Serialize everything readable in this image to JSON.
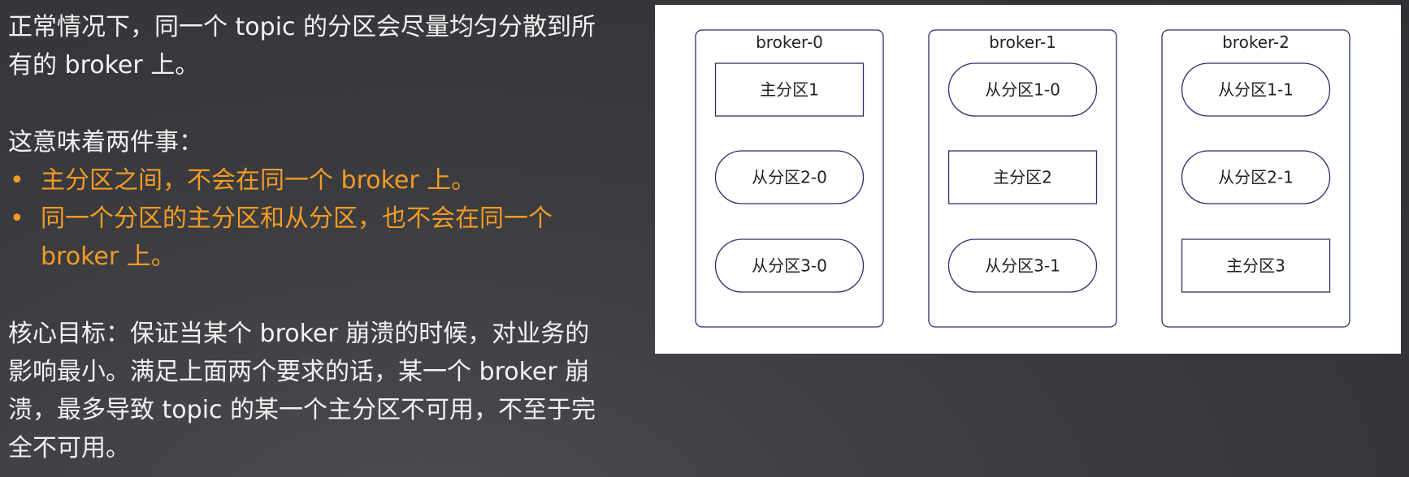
{
  "text": {
    "intro": "正常情况下，同一个 topic 的分区会尽量均匀分散到所有的 broker 上。",
    "meaning_heading": "这意味着两件事：",
    "bullets": [
      "主分区之间，不会在同一个 broker 上。",
      "同一个分区的主分区和从分区，也不会在同一个 broker 上。"
    ],
    "goal": "核心目标：保证当某个 broker 崩溃的时候，对业务的影响最小。满足上面两个要求的话，某一个 broker 崩溃，最多导致 topic 的某一个主分区不可用，不至于完全不可用。"
  },
  "bullet_glyph": "•",
  "colors": {
    "highlight": "#f59a23",
    "body_text": "#f2f2f2",
    "diagram_stroke": "#2b2f6e",
    "panel_bg": "#ffffff"
  },
  "diagram": {
    "brokers": [
      {
        "label": "broker-0",
        "partitions": [
          {
            "label": "主分区1",
            "role": "leader"
          },
          {
            "label": "从分区2-0",
            "role": "follower"
          },
          {
            "label": "从分区3-0",
            "role": "follower"
          }
        ]
      },
      {
        "label": "broker-1",
        "partitions": [
          {
            "label": "从分区1-0",
            "role": "follower"
          },
          {
            "label": "主分区2",
            "role": "leader"
          },
          {
            "label": "从分区3-1",
            "role": "follower"
          }
        ]
      },
      {
        "label": "broker-2",
        "partitions": [
          {
            "label": "从分区1-1",
            "role": "follower"
          },
          {
            "label": "从分区2-1",
            "role": "follower"
          },
          {
            "label": "主分区3",
            "role": "leader"
          }
        ]
      }
    ]
  }
}
